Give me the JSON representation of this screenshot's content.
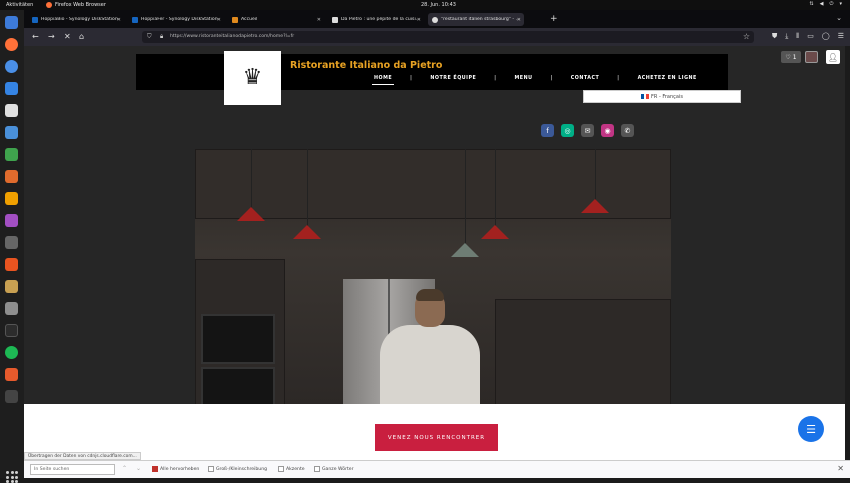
{
  "system": {
    "activities": "Aktivitäten",
    "app_name": "Firefox Web Browser",
    "clock": "28. Jun. 10:43"
  },
  "tabs": [
    {
      "label": "HoppiaBio - Synology DiskStation",
      "favicon_color": "#1565c0"
    },
    {
      "label": "HoppiaFer - Synology DiskStation",
      "favicon_color": "#1565c0"
    },
    {
      "label": "Accueil",
      "favicon_color": "#e08a1e"
    },
    {
      "label": "Da Pietro : une pépite de la cuisi...",
      "favicon_color": "#dddddd"
    },
    {
      "label": "\"restaurant italien strasbourg\" - ...",
      "favicon_color": "#dddddd"
    }
  ],
  "navigation": {
    "url": "https://www.ristoranteitalianodapietro.com/home?l=fr"
  },
  "site": {
    "title": "Ristorante Italiano da Pietro",
    "menu": [
      {
        "label": "HOME",
        "current": true
      },
      {
        "label": "NOTRE ÉQUIPE",
        "current": false
      },
      {
        "label": "MENU",
        "current": false
      },
      {
        "label": "CONTACT",
        "current": false
      },
      {
        "label": "ACHETEZ EN LIGNE",
        "current": false
      }
    ],
    "language": "FR - Français",
    "wishlist_count": "1",
    "socials": [
      {
        "name": "facebook-icon",
        "color": "#3b5998",
        "glyph": "f"
      },
      {
        "name": "tripadvisor-icon",
        "color": "#00af87",
        "glyph": "◎"
      },
      {
        "name": "mail-icon",
        "color": "#555555",
        "glyph": "✉"
      },
      {
        "name": "instagram-icon",
        "color": "#c13584",
        "glyph": "◉"
      },
      {
        "name": "phone-icon",
        "color": "#555555",
        "glyph": "✆"
      }
    ],
    "cta": "VENEZ NOUS RENCONTRER"
  },
  "status": {
    "text": "Übertragen der Daten von cdnjs.cloudflare.com..."
  },
  "findbar": {
    "placeholder": "In Seite suchen",
    "options": [
      {
        "label": "Alle hervorheben",
        "checked": true
      },
      {
        "label": "Groß-/Kleinschreibung",
        "checked": false
      },
      {
        "label": "Akzente",
        "checked": false
      },
      {
        "label": "Ganze Wörter",
        "checked": false
      }
    ]
  },
  "colors": {
    "brand_title": "#e8a223",
    "cta": "#c91f3f",
    "chat": "#1a73e8"
  }
}
